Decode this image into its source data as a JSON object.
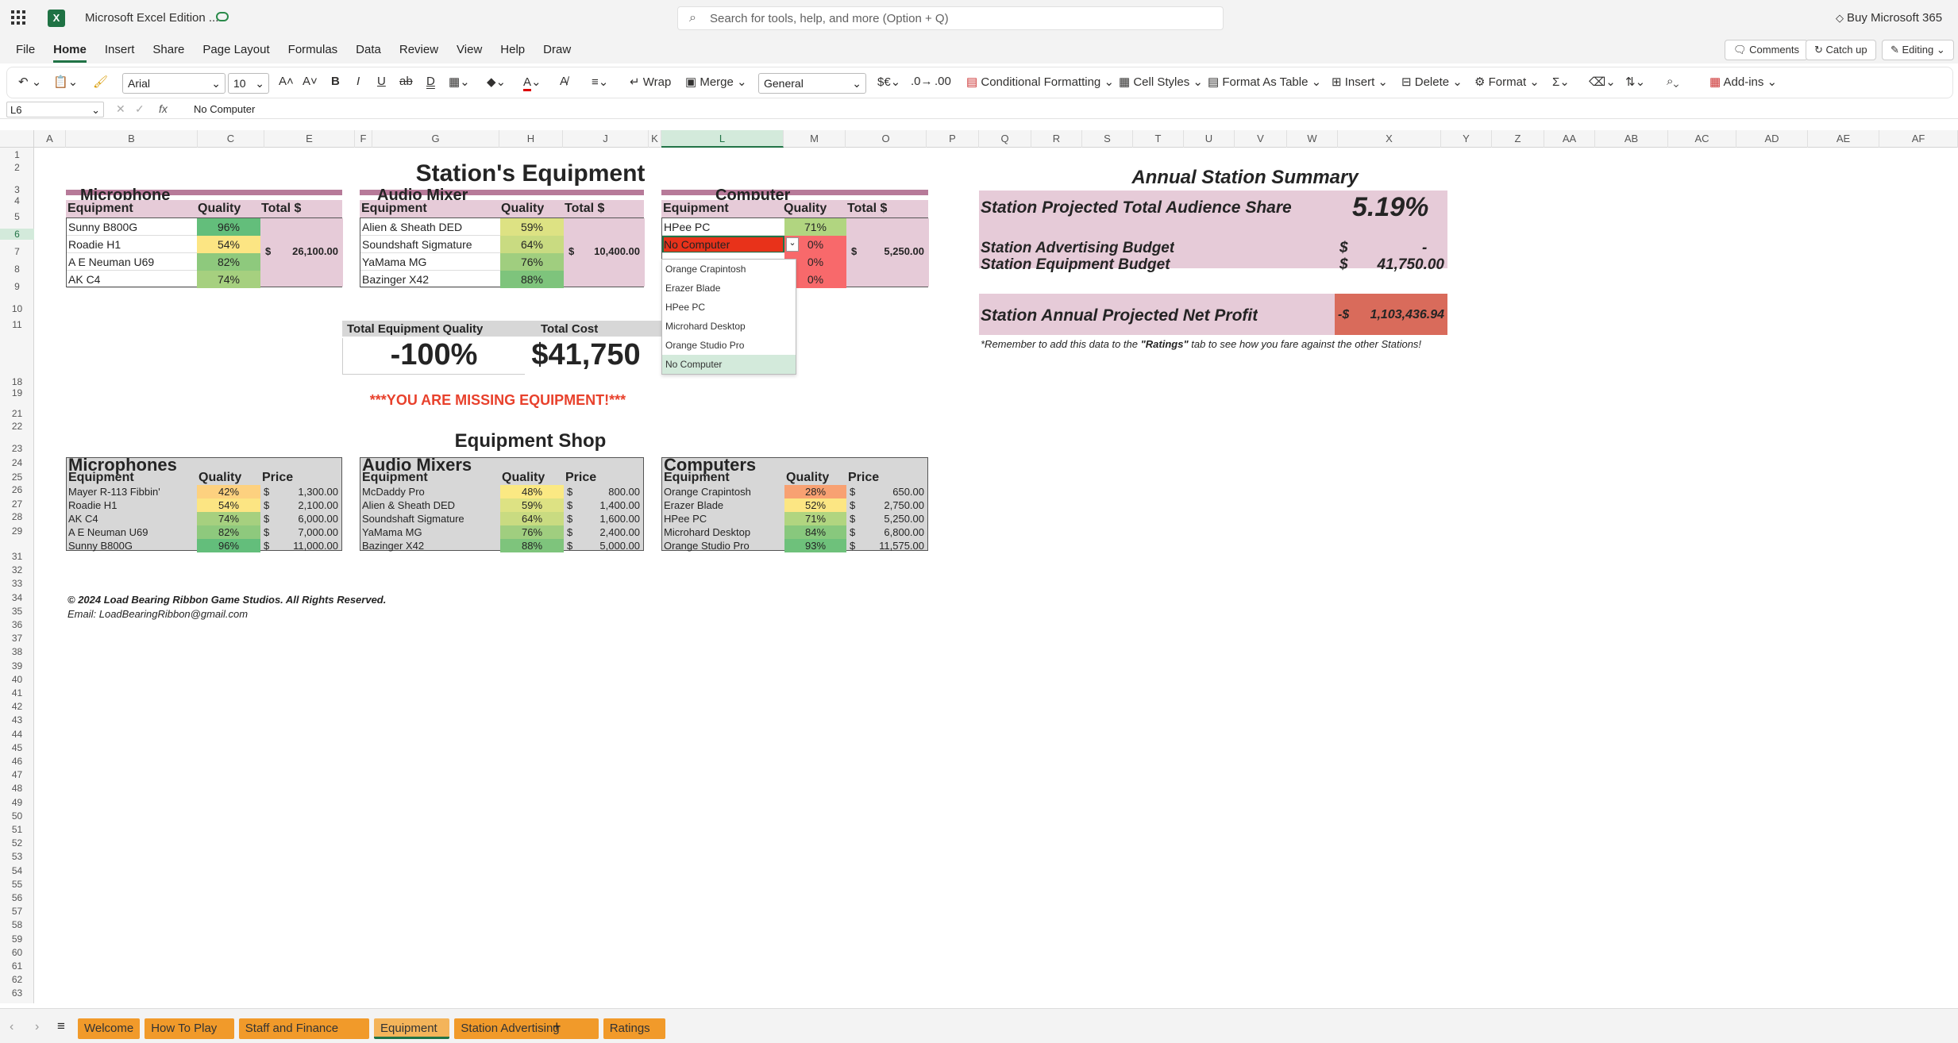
{
  "app": {
    "title": "Microsoft Excel Edition ...",
    "search_placeholder": "Search for tools, help, and more (Option + Q)",
    "buy": "Buy Microsoft 365"
  },
  "menu": [
    "File",
    "Home",
    "Insert",
    "Share",
    "Page Layout",
    "Formulas",
    "Data",
    "Review",
    "View",
    "Help",
    "Draw"
  ],
  "menu_right": {
    "comments": "Comments",
    "catchup": "Catch up",
    "editing": "Editing"
  },
  "ribbon": {
    "font": "Arial",
    "size": "10",
    "wrap": "Wrap",
    "merge": "Merge",
    "numfmt": "General",
    "cond": "Conditional Formatting",
    "cellstyles": "Cell Styles",
    "fmttable": "Format As Table",
    "insert": "Insert",
    "delete": "Delete",
    "format": "Format",
    "addins": "Add-ins"
  },
  "formula": {
    "namebox": "L6",
    "fx": "fx",
    "content": "No Computer"
  },
  "columns": [
    "A",
    "B",
    "C",
    "E",
    "F",
    "G",
    "H",
    "J",
    "K",
    "L",
    "M",
    "O",
    "P",
    "Q",
    "R",
    "S",
    "T",
    "U",
    "V",
    "W",
    "X",
    "Y",
    "Z",
    "AA",
    "AB",
    "AC",
    "AD",
    "AE",
    "AF"
  ],
  "rows": [
    "1",
    "2",
    "3",
    "4",
    "5",
    "6",
    "7",
    "8",
    "9",
    "10",
    "11",
    "18",
    "19",
    "21",
    "22",
    "23",
    "24",
    "25",
    "26",
    "27",
    "28",
    "29",
    "31",
    "32",
    "33",
    "34",
    "35",
    "36",
    "37",
    "38",
    "39",
    "40",
    "41",
    "42",
    "43",
    "44",
    "45",
    "46",
    "47",
    "48",
    "49",
    "50",
    "51",
    "52",
    "53",
    "54",
    "55",
    "56",
    "57",
    "58",
    "59",
    "60",
    "61",
    "62",
    "63"
  ],
  "station": {
    "title": "Station's Equipment",
    "headers": {
      "equipment": "Equipment",
      "quality": "Quality",
      "total": "Total $"
    },
    "mic": {
      "name": "Microphone",
      "items": [
        {
          "n": "Sunny B800G",
          "q": "96%"
        },
        {
          "n": "Roadie H1",
          "q": "54%"
        },
        {
          "n": "A E Neuman U69",
          "q": "82%"
        },
        {
          "n": "AK C4",
          "q": "74%"
        }
      ],
      "cur": "$",
      "total": "26,100.00"
    },
    "mixer": {
      "name": "Audio Mixer",
      "items": [
        {
          "n": "Alien & Sheath DED",
          "q": "59%"
        },
        {
          "n": "Soundshaft Sigmature",
          "q": "64%"
        },
        {
          "n": "YaMama MG",
          "q": "76%"
        },
        {
          "n": "Bazinger X42",
          "q": "88%"
        }
      ],
      "cur": "$",
      "total": "10,400.00"
    },
    "comp": {
      "name": "Computer",
      "items": [
        {
          "n": "HPee PC",
          "q": "71%"
        },
        {
          "n": "No Computer",
          "q": "0%"
        },
        {
          "n": "",
          "q": "0%"
        },
        {
          "n": "",
          "q": "0%"
        }
      ],
      "cur": "$",
      "total": "5,250.00"
    },
    "tq_label": "Total Equipment Quality",
    "tc_label": "Total Cost",
    "tq": "-100%",
    "tc": "$41,750",
    "missing": "***YOU ARE MISSING EQUIPMENT!***"
  },
  "dropdown": [
    "Orange Crapintosh",
    "Erazer Blade",
    "HPee PC",
    "Microhard Desktop",
    "Orange Studio Pro",
    "No Computer"
  ],
  "shop": {
    "title": "Equipment Shop",
    "headers": {
      "equipment": "Equipment",
      "quality": "Quality",
      "price": "Price",
      "cur": "$"
    },
    "mics": {
      "name": "Microphones",
      "items": [
        {
          "n": "Mayer R-113 Fibbin'",
          "q": "42%",
          "p": "1,300.00"
        },
        {
          "n": "Roadie H1",
          "q": "54%",
          "p": "2,100.00"
        },
        {
          "n": "AK C4",
          "q": "74%",
          "p": "6,000.00"
        },
        {
          "n": "A E Neuman U69",
          "q": "82%",
          "p": "7,000.00"
        },
        {
          "n": "Sunny B800G",
          "q": "96%",
          "p": "11,000.00"
        }
      ]
    },
    "mixers": {
      "name": "Audio Mixers",
      "items": [
        {
          "n": "McDaddy Pro",
          "q": "48%",
          "p": "800.00"
        },
        {
          "n": "Alien & Sheath DED",
          "q": "59%",
          "p": "1,400.00"
        },
        {
          "n": "Soundshaft Sigmature",
          "q": "64%",
          "p": "1,600.00"
        },
        {
          "n": "YaMama MG",
          "q": "76%",
          "p": "2,400.00"
        },
        {
          "n": "Bazinger X42",
          "q": "88%",
          "p": "5,000.00"
        }
      ]
    },
    "comps": {
      "name": "Computers",
      "items": [
        {
          "n": "Orange Crapintosh",
          "q": "28%",
          "p": "650.00"
        },
        {
          "n": "Erazer Blade",
          "q": "52%",
          "p": "2,750.00"
        },
        {
          "n": "HPee PC",
          "q": "71%",
          "p": "5,250.00"
        },
        {
          "n": "Microhard Desktop",
          "q": "84%",
          "p": "6,800.00"
        },
        {
          "n": "Orange Studio Pro",
          "q": "93%",
          "p": "11,575.00"
        }
      ]
    }
  },
  "summary": {
    "title": "Annual Station Summary",
    "share_label": "Station Projected Total Audience Share",
    "share": "5.19%",
    "adv_label": "Station Advertising Budget",
    "adv_cur": "$",
    "adv": "-",
    "eq_label": "Station Equipment Budget",
    "eq_cur": "$",
    "eq": "41,750.00",
    "profit_label": "Station Annual Projected Net Profit",
    "profit_cur": "-$",
    "profit": "1,103,436.94",
    "note_pre": "*Remember to add this data to the ",
    "note_bold": "\"Ratings\"",
    "note_post": " tab to see how you fare against the other Stations!"
  },
  "footer": {
    "copy": "© 2024 Load Bearing Ribbon Game Studios. All Rights Reserved.",
    "email": "Email: LoadBearingRibbon@gmail.com"
  },
  "sheets": [
    "Welcome",
    "How To Play",
    "Staff and Finance",
    "Equipment",
    "Station Advertising",
    "Ratings"
  ],
  "colors": {
    "q96": "#63be7b",
    "q54": "#fce583",
    "q82": "#8ec97d",
    "q74": "#a6d07f",
    "q59": "#dde283",
    "q64": "#c9db81",
    "q76": "#a0ce7f",
    "q88": "#7ec47c",
    "q71": "#b1d580",
    "q0": "#f8696b",
    "q42": "#fdd17f",
    "q48": "#fbe983",
    "q28": "#f8a172",
    "q52": "#fce683",
    "q84": "#88c87d",
    "q93": "#6ec17b"
  }
}
